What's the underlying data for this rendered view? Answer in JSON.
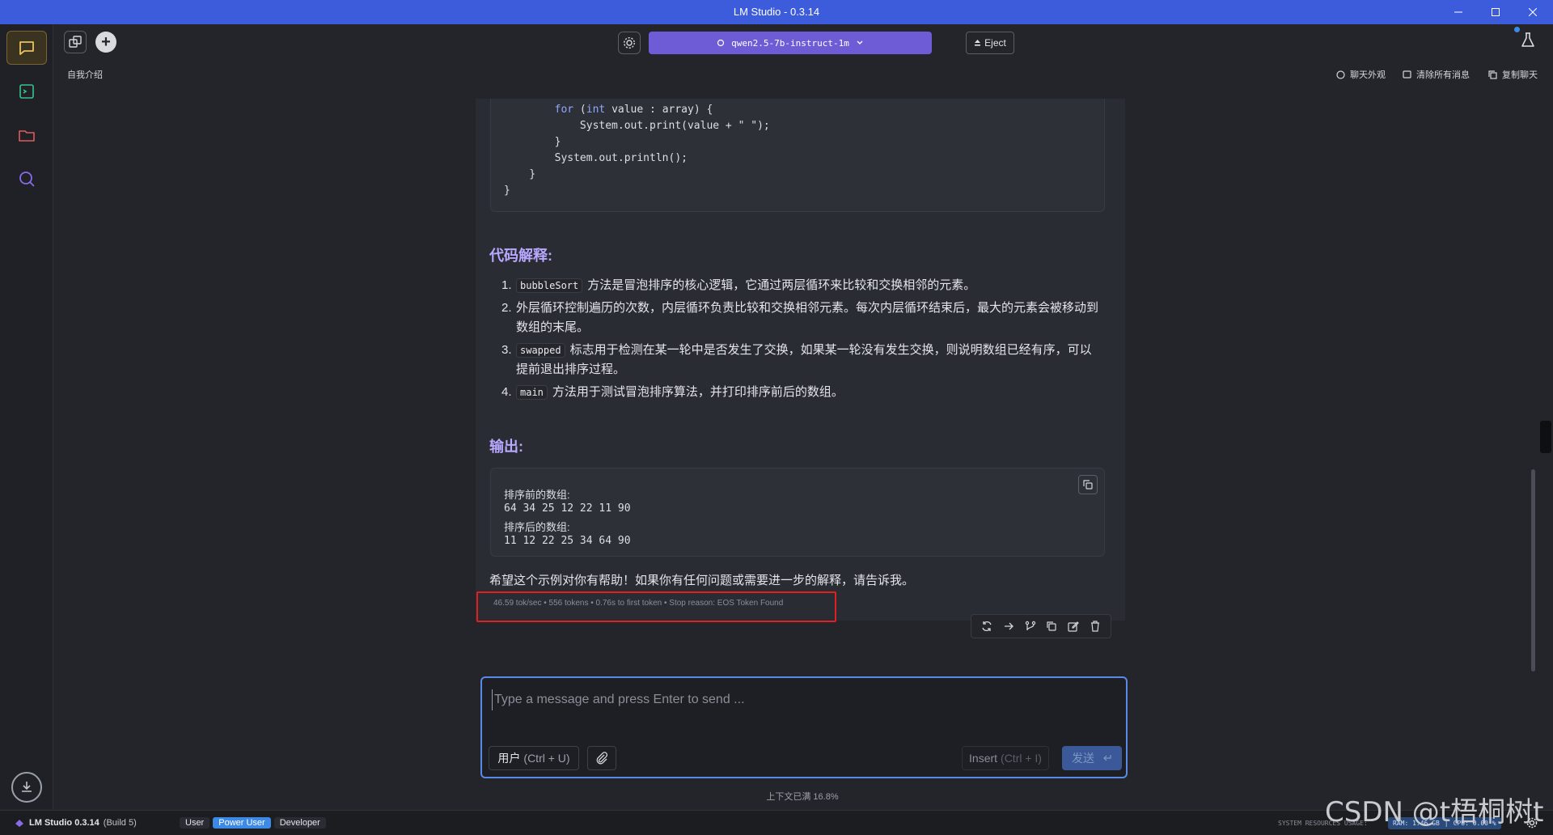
{
  "window": {
    "title": "LM Studio - 0.3.14"
  },
  "toolbar": {
    "model_name": "qwen2.5-7b-instruct-1m",
    "eject_label": "Eject"
  },
  "subheader": {
    "chat_title": "自我介绍",
    "actions": [
      "聊天外观",
      "清除所有消息",
      "复制聊天"
    ]
  },
  "message": {
    "code_lines": [
      "        for (int value : array) {",
      "            System.out.print(value + \" \");",
      "        }",
      "        System.out.println();",
      "    }",
      "}"
    ],
    "explain_heading": "代码解释:",
    "explain_items": [
      {
        "num": "1.",
        "code": "bubbleSort",
        "text": "方法是冒泡排序的核心逻辑，它通过两层循环来比较和交换相邻的元素。"
      },
      {
        "num": "2.",
        "code": "",
        "text": "外层循环控制遍历的次数，内层循环负责比较和交换相邻元素。每次内层循环结束后，最大的元素会被移动到数组的末尾。"
      },
      {
        "num": "3.",
        "code": "swapped",
        "text": "标志用于检测在某一轮中是否发生了交换，如果某一轮没有发生交换，则说明数组已经有序，可以提前退出排序过程。"
      },
      {
        "num": "4.",
        "code": "main",
        "text": "方法用于测试冒泡排序算法，并打印排序前后的数组。"
      }
    ],
    "output_heading": "输出:",
    "output_lines": [
      "排序前的数组:",
      "64 34 25 12 22 11 90",
      "排序后的数组:",
      "11 12 22 25 34 64 90"
    ],
    "closing": "希望这个示例对你有帮助！如果你有任何问题或需要进一步的解释，请告诉我。",
    "stats": "46.59 tok/sec • 556 tokens • 0.76s to first token • Stop reason: EOS Token Found"
  },
  "composer": {
    "placeholder": "Type a message and press Enter to send ...",
    "role_label": "用户",
    "role_hint": "(Ctrl + U)",
    "insert_label": "Insert",
    "insert_hint": "(Ctrl + I)",
    "send_label": "发送",
    "context_status": "上下文已满 16.8%"
  },
  "statusbar": {
    "app_name": "LM Studio 0.3.14",
    "build": "(Build 5)",
    "modes": [
      "User",
      "Power User",
      "Developer"
    ],
    "active_mode": "Power User",
    "sys_label": "SYSTEM RESOURCES USAGE:",
    "ram": "RAM: 1.46 GB",
    "cpu": "CPU: 0.00 %"
  },
  "watermark": "CSDN @t梧桐树t",
  "colors": {
    "titlebar": "#3c5cdc",
    "model_button": "#6e5cd6",
    "accent_heading": "#b8a8ff",
    "active_mode": "#3c8ae6",
    "highlight_box": "#e02020"
  }
}
